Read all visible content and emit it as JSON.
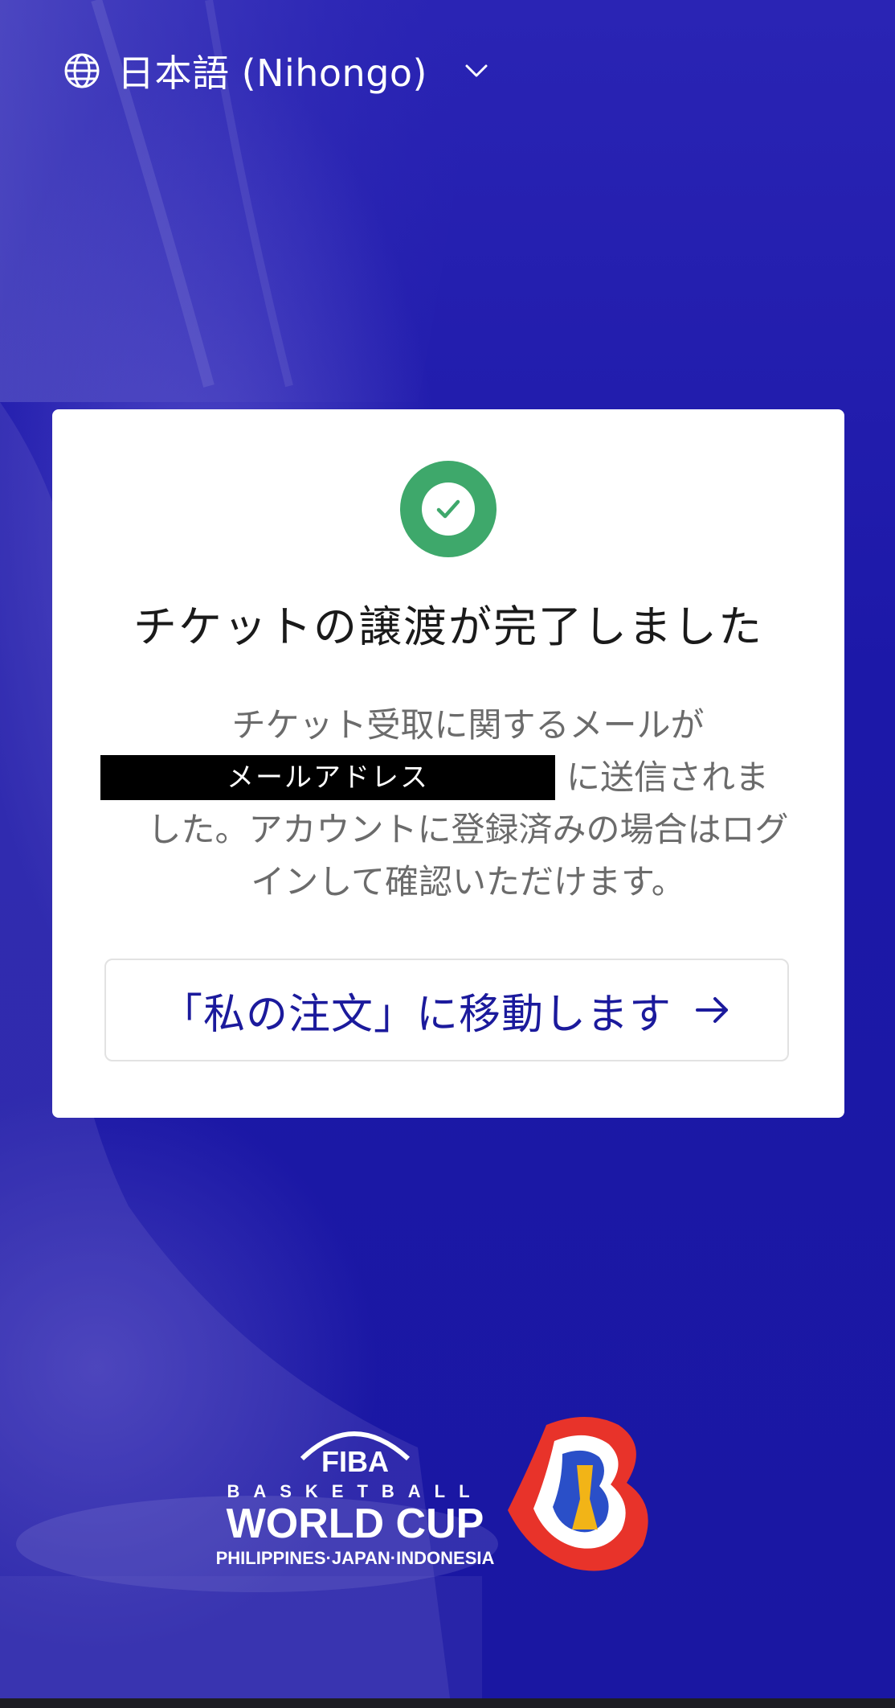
{
  "language_selector": {
    "label": "日本語 (Nihongo)",
    "globe_icon": "globe-icon",
    "chevron_icon": "chevron-down-icon"
  },
  "card": {
    "status_icon": "check-circle-icon",
    "title": "チケットの譲渡が完了しました",
    "message_line1": "チケット受取に関するメールが",
    "redacted_email": "メールアドレス",
    "message_line2_suffix": "に送信されま",
    "message_line3": "した。アカウントに登録済みの場合はログ",
    "message_line4": "インして確認いただけます。",
    "button_label": "「私の注文」に移動します",
    "button_icon": "arrow-right-icon"
  },
  "footer_logo": {
    "fiba_text": "FIBA",
    "line1": "BASKETBALL",
    "line2": "WORLD CUP",
    "line3": "PHILIPPINES·JAPAN·INDONESIA"
  },
  "colors": {
    "background": "#1a1a9e",
    "accent": "#1b1a9c",
    "success": "#3ea86b"
  }
}
